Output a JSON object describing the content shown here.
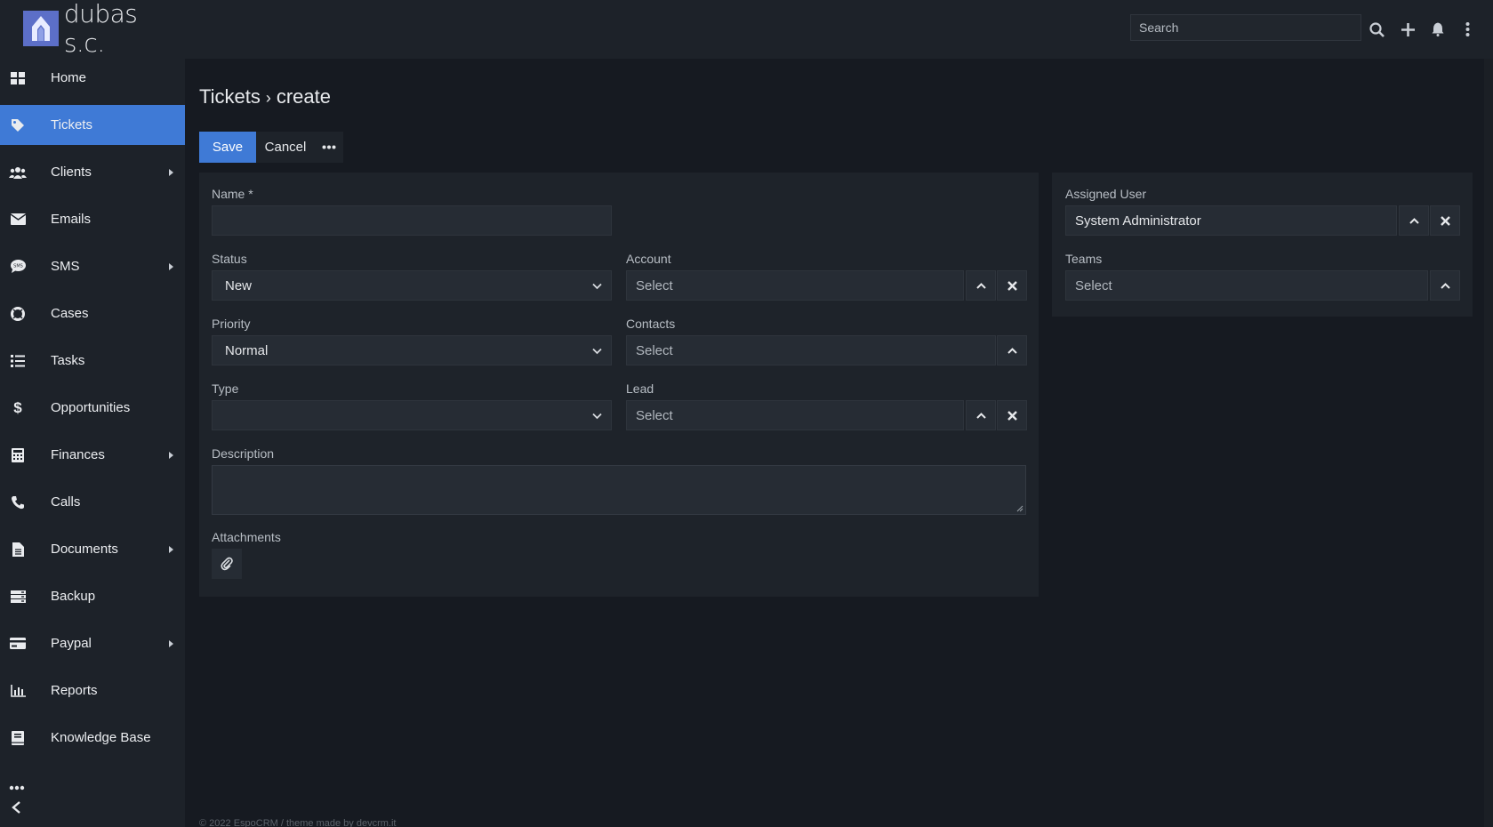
{
  "brand": {
    "name": "dubas s.c."
  },
  "sidebar": {
    "items": [
      {
        "label": "Home",
        "icon": "grid-icon",
        "has_submenu": false
      },
      {
        "label": "Tickets",
        "icon": "tag-icon",
        "has_submenu": false,
        "active": true
      },
      {
        "label": "Clients",
        "icon": "users-icon",
        "has_submenu": true
      },
      {
        "label": "Emails",
        "icon": "envelope-icon",
        "has_submenu": false
      },
      {
        "label": "SMS",
        "icon": "sms-icon",
        "has_submenu": true
      },
      {
        "label": "Cases",
        "icon": "lifebuoy-icon",
        "has_submenu": false
      },
      {
        "label": "Tasks",
        "icon": "list-icon",
        "has_submenu": false
      },
      {
        "label": "Opportunities",
        "icon": "dollar-icon",
        "has_submenu": false
      },
      {
        "label": "Finances",
        "icon": "calculator-icon",
        "has_submenu": true
      },
      {
        "label": "Calls",
        "icon": "phone-icon",
        "has_submenu": false
      },
      {
        "label": "Documents",
        "icon": "file-icon",
        "has_submenu": true
      },
      {
        "label": "Backup",
        "icon": "server-icon",
        "has_submenu": false
      },
      {
        "label": "Paypal",
        "icon": "credit-card-icon",
        "has_submenu": true
      },
      {
        "label": "Reports",
        "icon": "bar-chart-icon",
        "has_submenu": false
      },
      {
        "label": "Knowledge Base",
        "icon": "book-icon",
        "has_submenu": false
      }
    ]
  },
  "topbar": {
    "search_placeholder": "Search"
  },
  "page": {
    "module": "Tickets",
    "separator": "›",
    "action": "create"
  },
  "buttons": {
    "save": "Save",
    "cancel": "Cancel"
  },
  "form": {
    "name_label": "Name *",
    "status_label": "Status",
    "status_value": "New",
    "priority_label": "Priority",
    "priority_value": "Normal",
    "type_label": "Type",
    "type_value": "",
    "account_label": "Account",
    "account_placeholder": "Select",
    "contacts_label": "Contacts",
    "contacts_placeholder": "Select",
    "lead_label": "Lead",
    "lead_placeholder": "Select",
    "description_label": "Description",
    "attachments_label": "Attachments"
  },
  "side_panel": {
    "assigned_user_label": "Assigned User",
    "assigned_user_value": "System Administrator",
    "teams_label": "Teams",
    "teams_placeholder": "Select"
  },
  "footer": {
    "text": "© 2022 EspoCRM / theme made by devcrm.it"
  },
  "colors": {
    "accent": "#3f7ad6",
    "background": "#161a21",
    "panel": "#1e232a"
  }
}
